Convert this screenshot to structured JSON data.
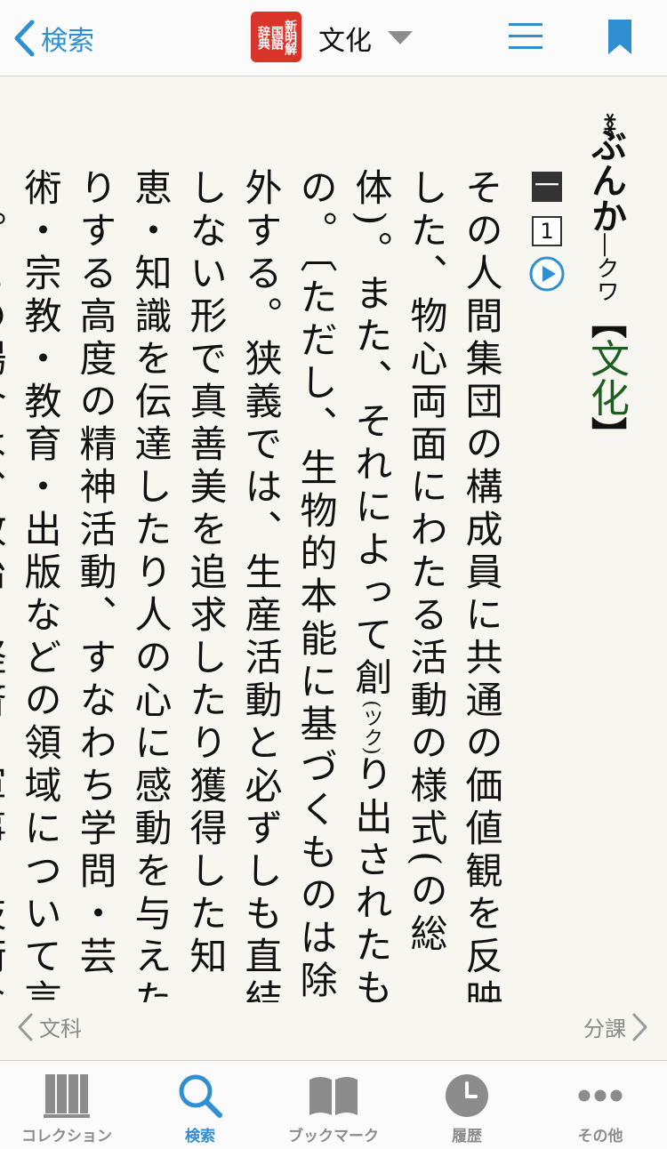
{
  "topbar": {
    "back_label": "検索",
    "badge_lines": [
      "新明解",
      "国語",
      "辞典"
    ],
    "title": "文化"
  },
  "entry": {
    "marks": "**",
    "reading": "ぶんか",
    "reading_suffix": "―クワ",
    "bracket_open": "【",
    "kanji": "文化",
    "bracket_close": "】",
    "sense_number": "一",
    "sub_sense_number": "1",
    "body_1": "その人間集団の構成員に共通の価値観を反映した、物心両面にわたる活動の様式(の総体)。また、それによって創",
    "ruby": "(ツク)",
    "body_2": "り出されたもの。〔ただし、生物的本能に基づくものは除外する。狭義では、生産活動と必ずしも直結しない形で真善美を追求したり獲得した知恵・知識を伝達したり人の心に感動を与えたりする高度の精神活動、すなわち学問・芸術・宗教・教育・出版などの領域について言う。この場合は、政治・経済・軍事・技術などの領域と対比され、そのことを強調するために「精"
  },
  "navigation": {
    "prev": "文科",
    "next": "分課"
  },
  "tabs": [
    {
      "label": "コレクション",
      "icon": "books-icon",
      "active": false
    },
    {
      "label": "検索",
      "icon": "search-icon",
      "active": true
    },
    {
      "label": "ブックマーク",
      "icon": "open-book-icon",
      "active": false
    },
    {
      "label": "履歴",
      "icon": "clock-icon",
      "active": false
    },
    {
      "label": "その他",
      "icon": "more-icon",
      "active": false
    }
  ],
  "colors": {
    "accent": "#2f8fd0",
    "badge": "#d8342a",
    "kanji_green": "#1b5e20",
    "tab_inactive": "#8c8c8c"
  }
}
